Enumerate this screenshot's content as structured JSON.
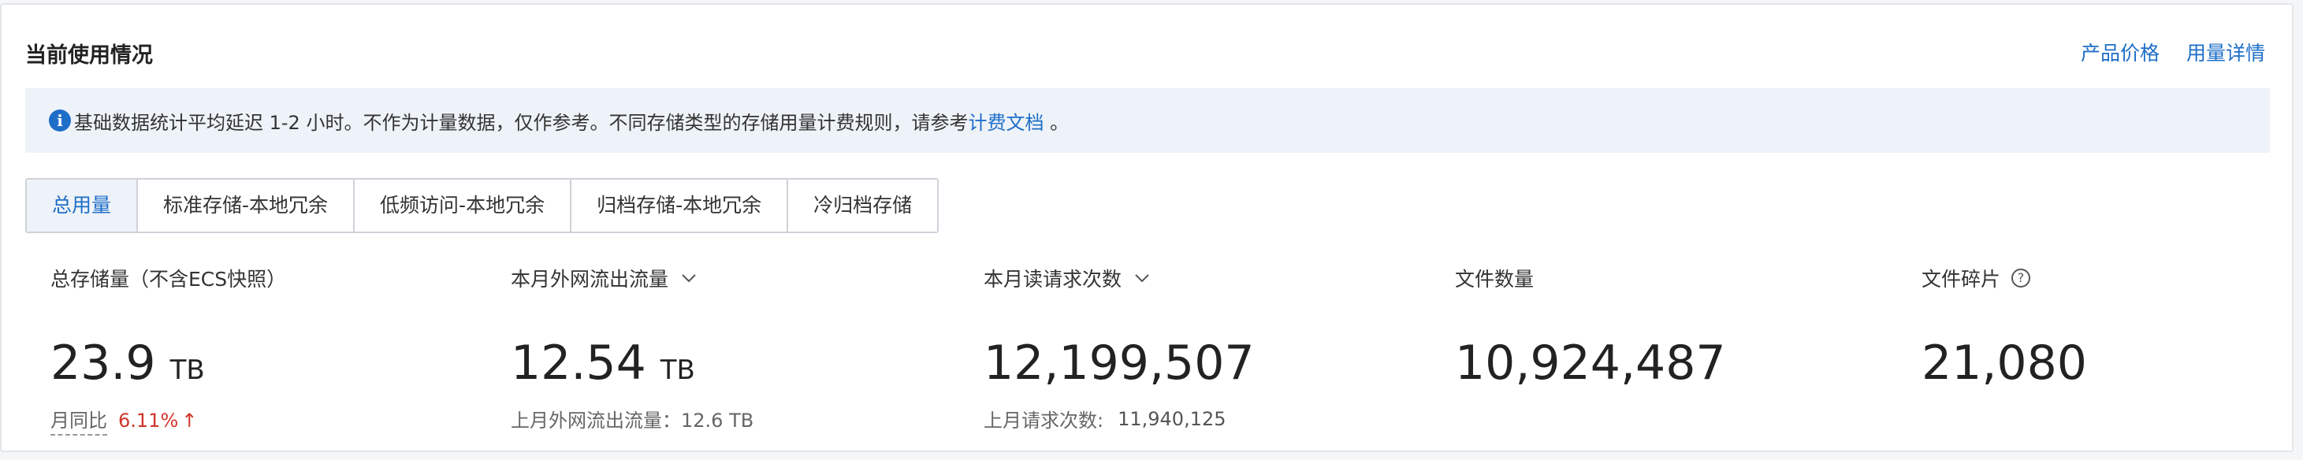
{
  "header": {
    "title": "当前使用情况",
    "links": [
      "产品价格",
      "用量详情"
    ]
  },
  "notice": {
    "icon": "info-icon",
    "text": "基础数据统计平均延迟 1-2 小时。不作为计量数据，仅作参考。不同存储类型的存储用量计费规则，请参考",
    "link": "计费文档",
    "suffix": " 。"
  },
  "tabs": [
    {
      "label": "总用量",
      "active": true
    },
    {
      "label": "标准存储-本地冗余",
      "active": false
    },
    {
      "label": "低频访问-本地冗余",
      "active": false
    },
    {
      "label": "归档存储-本地冗余",
      "active": false
    },
    {
      "label": "冷归档存储",
      "active": false
    }
  ],
  "metrics": {
    "storage": {
      "label": "总存储量（不含ECS快照）",
      "value": "23.9",
      "unit": "TB",
      "sub_label": "月同比",
      "sub_pct": "6.11%",
      "sub_arrow": "↑"
    },
    "egress": {
      "label": "本月外网流出流量",
      "value": "12.54",
      "unit": "TB",
      "sub_label": "上月外网流出流量：12.6 TB"
    },
    "reads": {
      "label": "本月读请求次数",
      "value": "12,199,507",
      "sub_label": "上月请求次数:",
      "sub_value": "11,940,125"
    },
    "files": {
      "label": "文件数量",
      "value": "10,924,487"
    },
    "fragments": {
      "label": "文件碎片",
      "value": "21,080"
    }
  },
  "colors": {
    "accent": "#1e6ec8",
    "up": "#d1342a",
    "notice_bg": "#eef3f9"
  }
}
